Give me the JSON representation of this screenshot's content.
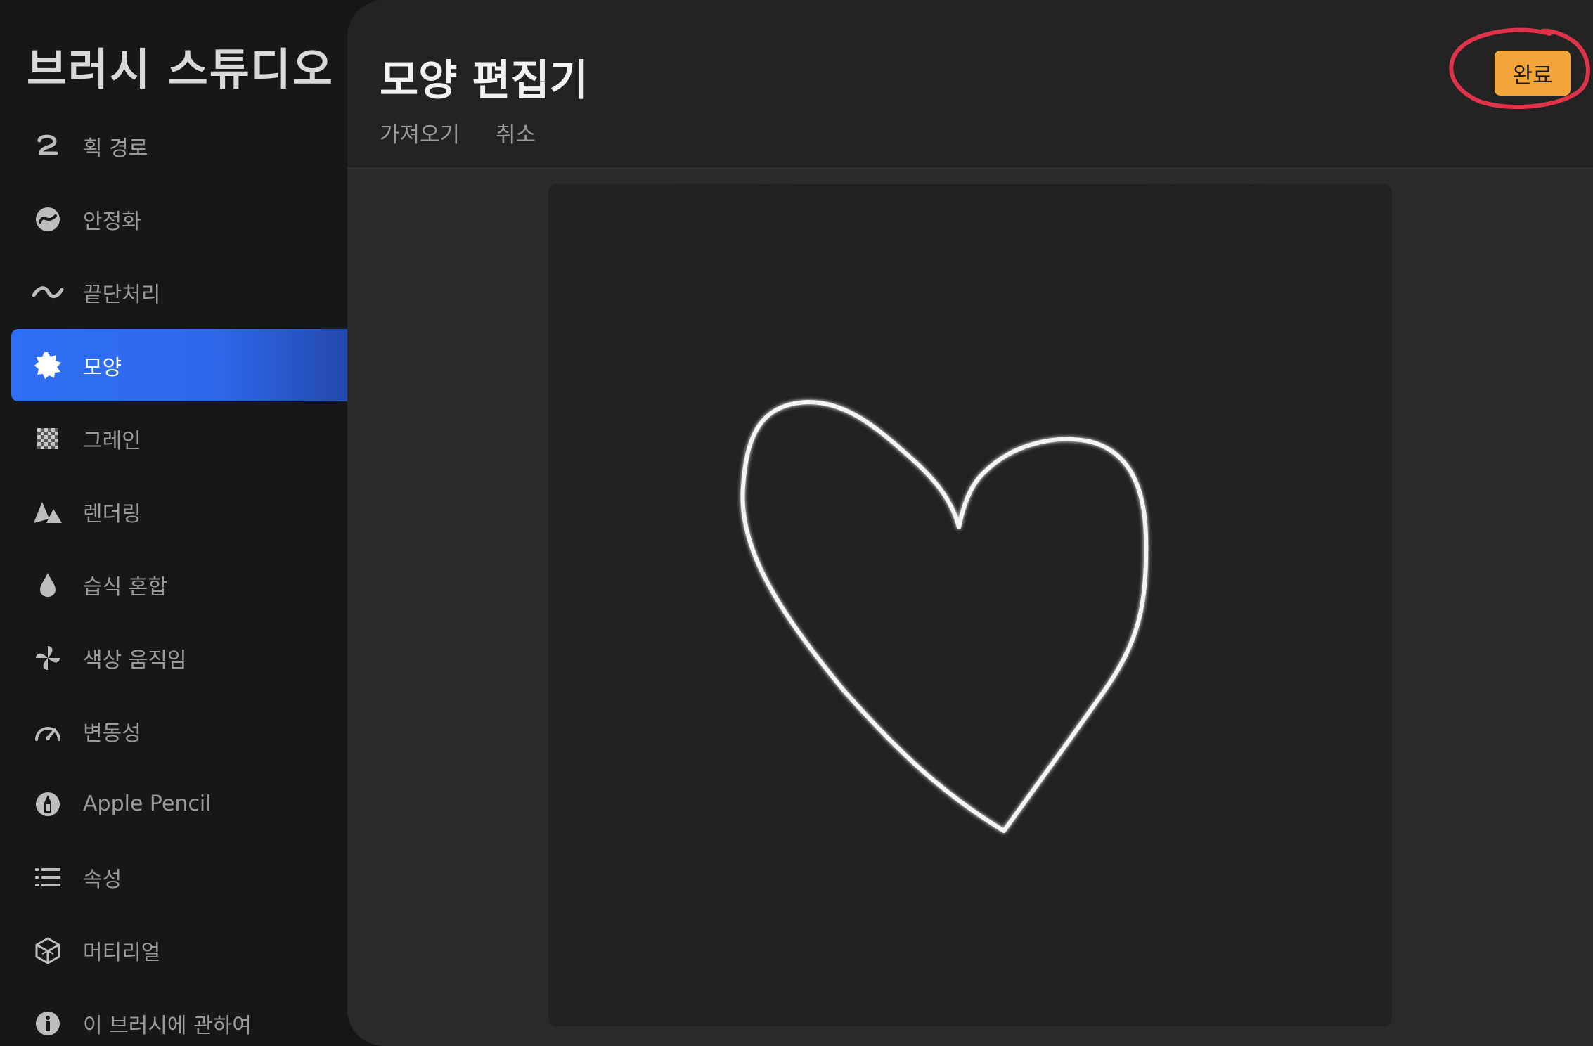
{
  "sidebar": {
    "title": "브러시 스튜디오",
    "items": [
      {
        "label": "획 경로",
        "icon": "stroke-path-icon"
      },
      {
        "label": "안정화",
        "icon": "stabilization-icon"
      },
      {
        "label": "끝단처리",
        "icon": "taper-icon"
      },
      {
        "label": "모양",
        "icon": "shape-icon",
        "active": true
      },
      {
        "label": "그레인",
        "icon": "grain-icon"
      },
      {
        "label": "렌더링",
        "icon": "rendering-icon"
      },
      {
        "label": "습식 혼합",
        "icon": "wet-mix-icon"
      },
      {
        "label": "색상 움직임",
        "icon": "color-dynamics-icon"
      },
      {
        "label": "변동성",
        "icon": "dynamics-icon"
      },
      {
        "label": "Apple Pencil",
        "icon": "apple-pencil-icon"
      },
      {
        "label": "속성",
        "icon": "properties-icon"
      },
      {
        "label": "머티리얼",
        "icon": "materials-icon"
      },
      {
        "label": "이 브러시에 관하여",
        "icon": "info-icon"
      }
    ]
  },
  "header": {
    "title": "모양 편집기",
    "import_label": "가져오기",
    "cancel_label": "취소",
    "done_label": "완료"
  },
  "colors": {
    "accent": "#f3a53a",
    "active_item": "#2f6ff5",
    "highlight_ring": "#e0334a"
  }
}
